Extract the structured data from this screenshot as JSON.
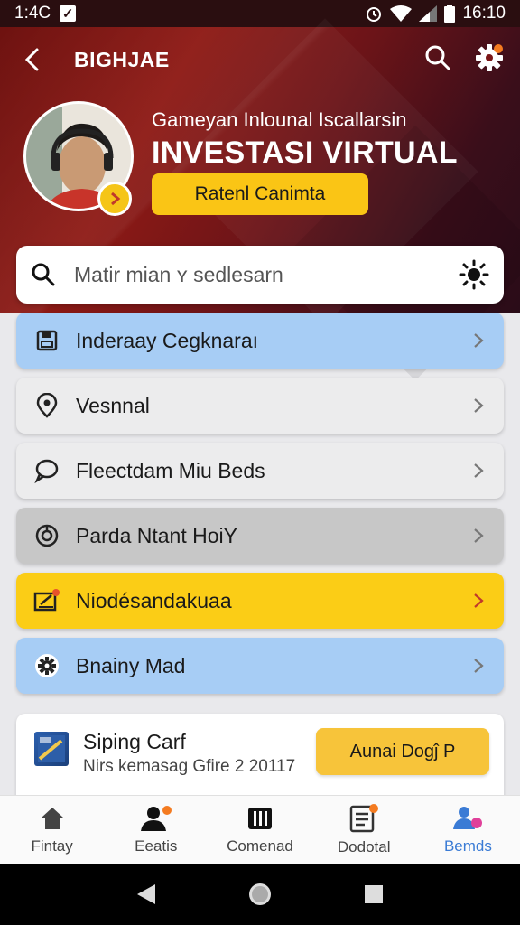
{
  "status_bar": {
    "time_left": "1:4С",
    "time_right": "16:10"
  },
  "header": {
    "title": "BIGHJAE"
  },
  "profile": {
    "subtitle": "Gameyan Inlounal Iscallarsin",
    "headline": "INVESTASI VIRTUAL",
    "button_label": "Ratenl Canimta"
  },
  "search": {
    "placeholder": "Matir mian ʏ sedlesаrn"
  },
  "menu": {
    "items": [
      {
        "label": "Inderaay Cegknaraı",
        "icon": "save-icon",
        "bg": "#a7cdf5"
      },
      {
        "label": "Vesnnal",
        "icon": "location-icon",
        "bg": "#ececed"
      },
      {
        "label": "Fleectdam Miu Beds",
        "icon": "chat-bubble-icon",
        "bg": "#ececed"
      },
      {
        "label": "Parda Ntant HoiY",
        "icon": "tag-icon",
        "bg": "#c7c7c7"
      },
      {
        "label": "Niodésandakuaa",
        "icon": "edit-note-icon",
        "bg": "#fbcd16"
      },
      {
        "label": "Bnainy Mad",
        "icon": "gear-icon",
        "bg": "#a7cdf5"
      }
    ]
  },
  "card": {
    "title": "Siping Carf",
    "subtitle": "Nirs kemasag Gfire 2 20117",
    "button_label": "Aunai Dogĵ P"
  },
  "bottom_nav": {
    "items": [
      {
        "label": "Fintay",
        "icon": "home-icon"
      },
      {
        "label": "Eeatis",
        "icon": "person-icon"
      },
      {
        "label": "Comenad",
        "icon": "columns-icon"
      },
      {
        "label": "Dodotal",
        "icon": "document-icon"
      },
      {
        "label": "Bemds",
        "icon": "people-icon"
      }
    ]
  },
  "colors": {
    "accent_yellow": "#fac515",
    "hero_red": "#8e1a15",
    "active_blue": "#3a7bd5",
    "light_blue": "#a7cdf5"
  }
}
